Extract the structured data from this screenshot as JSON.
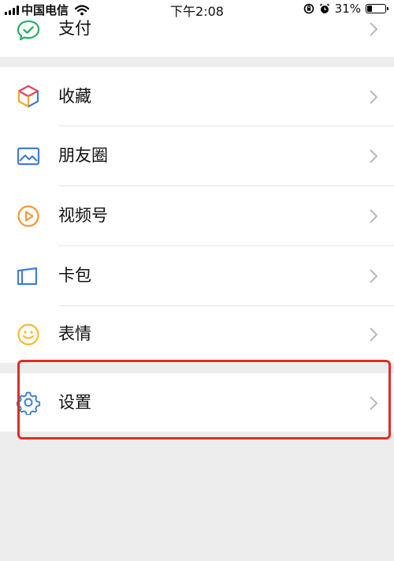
{
  "status_bar": {
    "carrier": "中国电信",
    "time": "下午2:08",
    "battery": "31%",
    "battery_level": 0.31
  },
  "menu": {
    "top_item": {
      "label": "支付",
      "icon": "pay-icon"
    },
    "group": [
      {
        "label": "收藏",
        "icon": "favorites-icon"
      },
      {
        "label": "朋友圈",
        "icon": "moments-icon"
      },
      {
        "label": "视频号",
        "icon": "channels-icon"
      },
      {
        "label": "卡包",
        "icon": "card-wallet-icon"
      },
      {
        "label": "表情",
        "icon": "stickers-icon"
      }
    ],
    "settings": {
      "label": "设置",
      "icon": "gear-icon"
    }
  },
  "colors": {
    "background": "#ededed",
    "card": "#ffffff",
    "green": "#2aae67",
    "blue": "#3f7fd1",
    "orange": "#f09a37",
    "yellow": "#f4bb32",
    "highlight": "#e22b2b"
  }
}
